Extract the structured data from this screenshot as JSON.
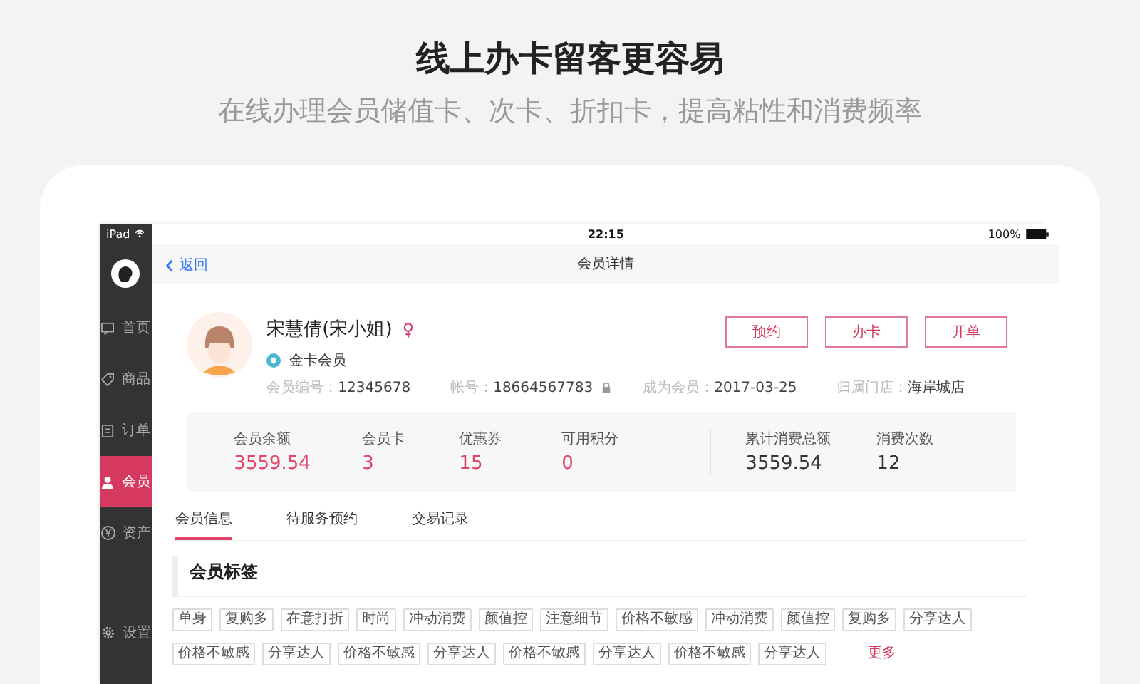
{
  "headline": "线上办卡留客更容易",
  "subheadline": "在线办理会员储值卡、次卡、折扣卡，提高粘性和消费频率",
  "status_bar": {
    "device": "iPad",
    "time": "22:15",
    "battery": "100%"
  },
  "sidebar": {
    "items": [
      {
        "label": "首页",
        "selected": false
      },
      {
        "label": "商品",
        "selected": false
      },
      {
        "label": "订单",
        "selected": false
      },
      {
        "label": "会员",
        "selected": true
      },
      {
        "label": "资产",
        "selected": false
      }
    ],
    "settings": {
      "label": "设置"
    }
  },
  "nav": {
    "back": "返回",
    "title": "会员详情"
  },
  "member": {
    "name": "宋慧倩(宋小姐)",
    "level": "金卡会员",
    "fields": [
      {
        "label": "会员编号：",
        "value": "12345678",
        "locked": false
      },
      {
        "label": "帐号：",
        "value": "18664567783",
        "locked": true
      },
      {
        "label": "成为会员：",
        "value": "2017-03-25",
        "locked": false
      },
      {
        "label": "归属门店：",
        "value": "海岸城店",
        "locked": false
      }
    ]
  },
  "actions": [
    "预约",
    "办卡",
    "开单"
  ],
  "stats": {
    "assets": [
      {
        "label": "会员余额",
        "value": "3559.54"
      },
      {
        "label": "会员卡",
        "value": "3"
      },
      {
        "label": "优惠券",
        "value": "15"
      },
      {
        "label": "可用积分",
        "value": "0"
      }
    ],
    "consumption": [
      {
        "label": "累计消费总额",
        "value": "3559.54"
      },
      {
        "label": "消费次数",
        "value": "12"
      }
    ]
  },
  "tabs": [
    {
      "label": "会员信息",
      "selected": true
    },
    {
      "label": "待服务预约",
      "selected": false
    },
    {
      "label": "交易记录",
      "selected": false
    }
  ],
  "tags_section": {
    "title": "会员标签",
    "tags": [
      "单身",
      "复购多",
      "在意打折",
      "时尚",
      "冲动消费",
      "颜值控",
      "注意细节",
      "价格不敏感",
      "冲动消费",
      "颜值控",
      "复购多",
      "分享达人",
      "价格不敏感",
      "分享达人",
      "价格不敏感",
      "分享达人",
      "价格不敏感",
      "分享达人",
      "价格不敏感",
      "分享达人"
    ],
    "more": "更多"
  }
}
